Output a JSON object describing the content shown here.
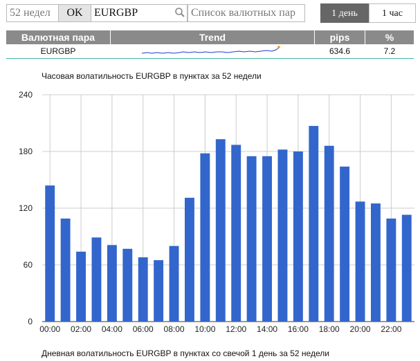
{
  "form": {
    "period_placeholder": "52 недел",
    "ok_label": "OK",
    "symbol_value": "EURGBP",
    "list_placeholder": "Список валютных пар"
  },
  "tabs": [
    {
      "label": "1 день",
      "active": true
    },
    {
      "label": "1 час",
      "active": false
    }
  ],
  "table": {
    "headers": [
      "Валютная пара",
      "Trend",
      "pips",
      "%"
    ],
    "rows": [
      {
        "pair": "EURGBP",
        "pips": "634.6",
        "percent": "7.2"
      }
    ]
  },
  "chart_title": "Часовая волатильность EURGBP в пунктах за 52 недели",
  "footer_title": "Дневная волатильность EURGBP в пунктах со свечой 1 день за 52 недели",
  "colors": {
    "bar": "#3366cc",
    "trend_line": "#1a3ccf",
    "trend_dot": "#ff9900",
    "header_bg": "#8a8a8a",
    "accent": "#43b4a6"
  },
  "chart_data": {
    "type": "bar",
    "title": "Часовая волатильность EURGBP в пунктах за 52 недели",
    "categories": [
      "00:00",
      "01:00",
      "02:00",
      "03:00",
      "04:00",
      "05:00",
      "06:00",
      "07:00",
      "08:00",
      "09:00",
      "10:00",
      "11:00",
      "12:00",
      "13:00",
      "14:00",
      "15:00",
      "16:00",
      "17:00",
      "18:00",
      "19:00",
      "20:00",
      "21:00",
      "22:00",
      "23:00"
    ],
    "tick_labels": [
      "00:00",
      "02:00",
      "04:00",
      "06:00",
      "08:00",
      "10:00",
      "12:00",
      "14:00",
      "16:00",
      "18:00",
      "20:00",
      "22:00"
    ],
    "values": [
      144,
      109,
      74,
      89,
      81,
      77,
      68,
      65,
      80,
      131,
      178,
      193,
      187,
      175,
      175,
      182,
      180,
      207,
      186,
      164,
      127,
      125,
      109,
      113
    ],
    "ylim": [
      0,
      240
    ],
    "yticks": [
      0,
      60,
      120,
      180,
      240
    ],
    "grid": true,
    "legend": "none"
  }
}
